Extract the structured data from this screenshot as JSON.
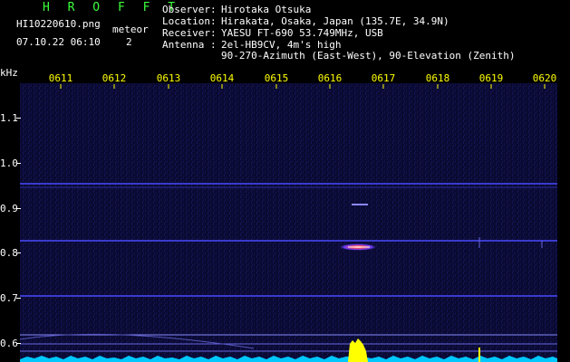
{
  "header": {
    "brand": "H R O F F T",
    "filename": "HI10220610.png",
    "meteor_label": "meteor",
    "meteor_count": "2",
    "datetime": "07.10.22 06:10",
    "info": [
      {
        "key": "Observer",
        "value": "Hirotaka Otsuka"
      },
      {
        "key": "Location",
        "value": "Hirakata, Osaka, Japan (135.7E, 34.9N)"
      },
      {
        "key": "Receiver",
        "value": "YAESU FT-690 53.749MHz, USB"
      },
      {
        "key": "Antenna",
        "value": "2el-HB9CV, 4m's high"
      }
    ],
    "antenna_line2": "90-270-Azimuth (East-West), 90-Elevation (Zenith)"
  },
  "axis": {
    "y_unit": "kHz",
    "y_ticks": [
      "1.1",
      "1.0",
      "0.9",
      "0.8",
      "0.7",
      "0.6"
    ],
    "x_ticks": [
      "0611",
      "0612",
      "0613",
      "0614",
      "0615",
      "0616",
      "0617",
      "0618",
      "0619",
      "0620"
    ]
  },
  "colors": {
    "background": "#0a0a32",
    "label": "#ffff00",
    "brand": "#3cff3c",
    "trace": "#00c8ff",
    "meteor": "#ffff00"
  }
}
